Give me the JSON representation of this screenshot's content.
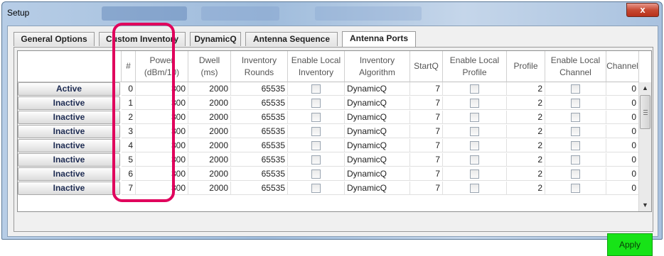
{
  "window": {
    "title": "Setup",
    "close_glyph": "x"
  },
  "tabs": [
    {
      "label": "General Options"
    },
    {
      "label": "Custom Inventory"
    },
    {
      "label": "DynamicQ"
    },
    {
      "label": "Antenna Sequence"
    },
    {
      "label": "Antenna Ports",
      "active": true
    }
  ],
  "table": {
    "headers": [
      "",
      "#",
      "Power\n(dBm/10)",
      "Dwell\n(ms)",
      "Inventory\nRounds",
      "Enable Local\nInventory",
      "Inventory\nAlgorithm",
      "StartQ",
      "Enable Local\nProfile",
      "Profile",
      "Enable Local\nChannel",
      "Channel"
    ],
    "rows": [
      {
        "status": "Active",
        "num": "0",
        "power": "300",
        "dwell": "2000",
        "rounds": "65535",
        "local_inventory": false,
        "algorithm": "DynamicQ",
        "startq": "7",
        "local_profile": false,
        "profile": "2",
        "local_channel": false,
        "channel": "0"
      },
      {
        "status": "Inactive",
        "num": "1",
        "power": "300",
        "dwell": "2000",
        "rounds": "65535",
        "local_inventory": false,
        "algorithm": "DynamicQ",
        "startq": "7",
        "local_profile": false,
        "profile": "2",
        "local_channel": false,
        "channel": "0"
      },
      {
        "status": "Inactive",
        "num": "2",
        "power": "300",
        "dwell": "2000",
        "rounds": "65535",
        "local_inventory": false,
        "algorithm": "DynamicQ",
        "startq": "7",
        "local_profile": false,
        "profile": "2",
        "local_channel": false,
        "channel": "0"
      },
      {
        "status": "Inactive",
        "num": "3",
        "power": "300",
        "dwell": "2000",
        "rounds": "65535",
        "local_inventory": false,
        "algorithm": "DynamicQ",
        "startq": "7",
        "local_profile": false,
        "profile": "2",
        "local_channel": false,
        "channel": "0"
      },
      {
        "status": "Inactive",
        "num": "4",
        "power": "300",
        "dwell": "2000",
        "rounds": "65535",
        "local_inventory": false,
        "algorithm": "DynamicQ",
        "startq": "7",
        "local_profile": false,
        "profile": "2",
        "local_channel": false,
        "channel": "0"
      },
      {
        "status": "Inactive",
        "num": "5",
        "power": "300",
        "dwell": "2000",
        "rounds": "65535",
        "local_inventory": false,
        "algorithm": "DynamicQ",
        "startq": "7",
        "local_profile": false,
        "profile": "2",
        "local_channel": false,
        "channel": "0"
      },
      {
        "status": "Inactive",
        "num": "6",
        "power": "300",
        "dwell": "2000",
        "rounds": "65535",
        "local_inventory": false,
        "algorithm": "DynamicQ",
        "startq": "7",
        "local_profile": false,
        "profile": "2",
        "local_channel": false,
        "channel": "0"
      },
      {
        "status": "Inactive",
        "num": "7",
        "power": "300",
        "dwell": "2000",
        "rounds": "65535",
        "local_inventory": false,
        "algorithm": "DynamicQ",
        "startq": "7",
        "local_profile": false,
        "profile": "2",
        "local_channel": false,
        "channel": "0"
      }
    ]
  },
  "scrollbar": {
    "up_icon": "▲",
    "down_icon": "▼",
    "thumb_icon": "grip-lines-icon"
  },
  "apply_button": {
    "label": "Apply"
  },
  "annotation": {
    "color": "#e0005c",
    "target_column": "Power (dBm/10)"
  },
  "colors": {
    "apply": "#17e317",
    "close": "#c74a33"
  }
}
